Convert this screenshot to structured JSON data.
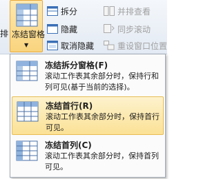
{
  "ribbon": {
    "cut_label": "排",
    "freeze_panes_label": "冻结窗格",
    "split_label": "拆分",
    "hide_label": "隐藏",
    "unhide_label": "取消隐藏",
    "view_side_by_side_label": "并排查看",
    "sync_scroll_label": "同步滚动",
    "reset_window_position_label": "重设窗口位置"
  },
  "menu": {
    "items": [
      {
        "title": "冻结拆分窗格(F)",
        "description": "滚动工作表其余部分时，保持行和列可见(基于当前的选择)。",
        "highlighted": false,
        "icon": "freeze-panes-icon"
      },
      {
        "title": "冻结首行(R)",
        "description": "滚动工作表其余部分时，保持首行可见。",
        "highlighted": true,
        "icon": "freeze-top-row-icon"
      },
      {
        "title": "冻结首列(C)",
        "description": "滚动工作表其余部分时，保持首列可见。",
        "highlighted": false,
        "icon": "freeze-first-column-icon"
      }
    ]
  },
  "colors": {
    "highlight": "#fbe196",
    "highlight_border": "#e7bd55",
    "ribbon_bg": "#e3eaf3"
  }
}
